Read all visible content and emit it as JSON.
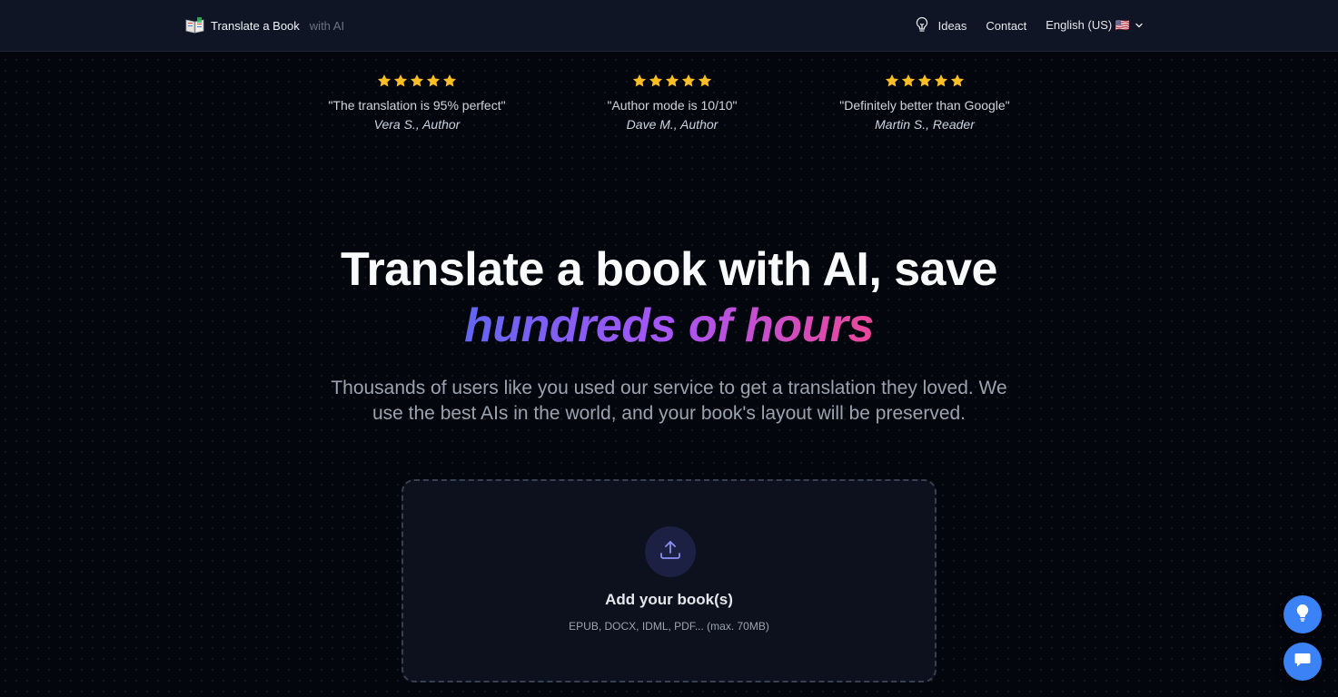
{
  "nav": {
    "brand_main": "Translate a Book",
    "brand_muted": "with AI",
    "ideas": "Ideas",
    "contact": "Contact",
    "language": "English (US) 🇺🇸"
  },
  "reviews": [
    {
      "stars": 5,
      "quote": "\"The translation is 95% perfect\"",
      "author": "Vera S., Author"
    },
    {
      "stars": 5,
      "quote": "\"Author mode is 10/10\"",
      "author": "Dave M., Author"
    },
    {
      "stars": 5,
      "quote": "\"Definitely better than Google\"",
      "author": "Martin S., Reader"
    }
  ],
  "hero": {
    "title_line1": "Translate a book with AI, save",
    "title_line2": "hundreds of hours",
    "subtitle": "Thousands of users like you used our service to get a translation they loved. We use the best AIs in the world, and your book's layout will be preserved."
  },
  "upload": {
    "title": "Add your book(s)",
    "formats": "EPUB, DOCX, IDML, PDF... (max. 70MB)"
  },
  "colors": {
    "star": "#fbbf24",
    "accent_blue": "#3b82f6",
    "gradient_start": "#6366f1",
    "gradient_mid": "#a855f7",
    "gradient_end": "#ec4899"
  },
  "icons": {
    "brand": "open-book-icon",
    "ideas": "lightbulb-icon",
    "language": "chevron-down-icon",
    "upload": "upload-icon",
    "fab_ideas": "lightbulb-icon",
    "fab_chat": "chat-icon"
  }
}
